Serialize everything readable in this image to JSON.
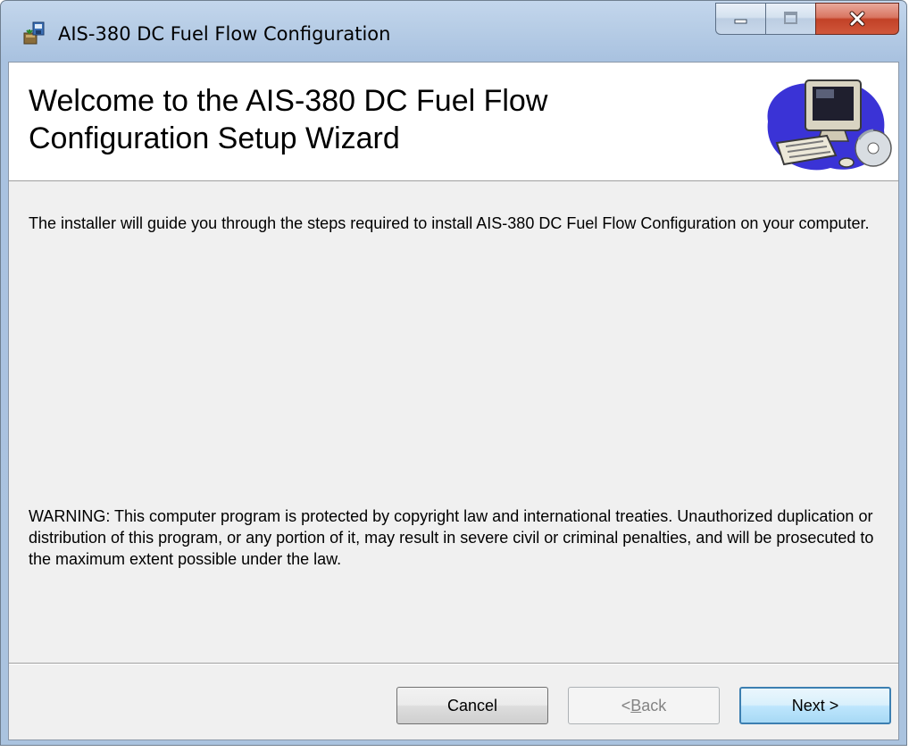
{
  "window": {
    "title": "AIS-380 DC Fuel Flow Configuration"
  },
  "header": {
    "title_line1": "Welcome to the AIS-380 DC Fuel Flow",
    "title_line2": "Configuration Setup Wizard",
    "graphic_icon": "computer-setup-icon"
  },
  "body": {
    "intro": "The installer will guide you through the steps required to install AIS-380 DC Fuel Flow Configuration on your computer.",
    "warning": "WARNING: This computer program is protected by copyright law and international treaties. Unauthorized duplication or distribution of this program, or any portion of it, may result in severe civil or criminal penalties, and will be prosecuted to the maximum extent possible under the law."
  },
  "buttons": {
    "cancel": "Cancel",
    "back_prefix": "< ",
    "back_mnemonic": "B",
    "back_rest": "ack",
    "next": "Next >"
  },
  "colors": {
    "titlebar": "#b7cde6",
    "close_button": "#c24127",
    "next_border": "#3c7fb1"
  }
}
